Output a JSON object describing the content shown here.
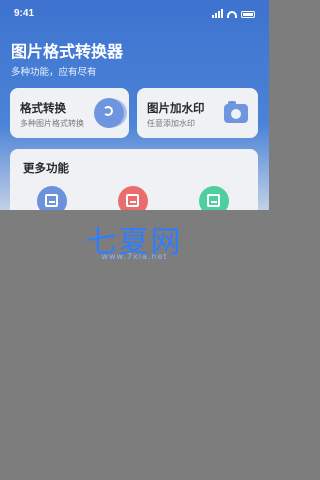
{
  "status_bar": {
    "time": "9:41"
  },
  "header": {
    "title": "图片格式转换器",
    "subtitle": "多种功能，应有尽有"
  },
  "cards": {
    "format_convert": {
      "title": "格式转换",
      "subtitle": "多种图片格式转换",
      "icon": "convert-icon"
    },
    "watermark": {
      "title": "图片加水印",
      "subtitle": "任意添加水印",
      "icon": "camera-icon"
    }
  },
  "more": {
    "title": "更多功能",
    "items": [
      {
        "icon": "image-icon",
        "color": "#6c91dd"
      },
      {
        "icon": "pdf-icon",
        "color": "#ea6d6d"
      },
      {
        "icon": "document-icon",
        "color": "#4fcf9f"
      }
    ]
  },
  "watermark_overlay": {
    "text": "七夏网",
    "url": "www.7xia.net"
  }
}
